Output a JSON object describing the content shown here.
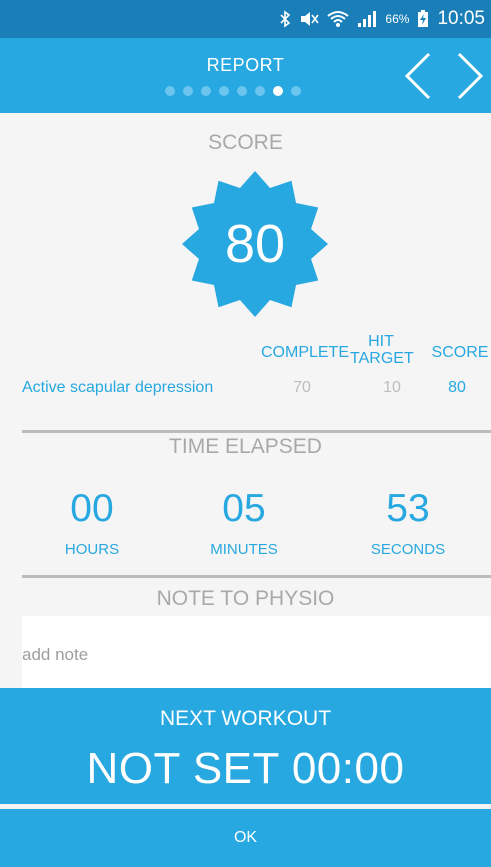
{
  "status_bar": {
    "battery_percent": "66%",
    "clock": "10:05",
    "icons": [
      "bluetooth-icon",
      "mute-icon",
      "wifi-icon",
      "signal-icon",
      "battery-charging-icon"
    ]
  },
  "header": {
    "title": "REPORT",
    "page_count": 8,
    "active_page": 7,
    "prev_icon": "chevron-left-icon",
    "next_icon": "chevron-right-icon"
  },
  "score": {
    "heading": "SCORE",
    "value": "80",
    "badge_color": "#27a8e0"
  },
  "results_table": {
    "columns": {
      "complete": "COMPLETE",
      "hit_target_line1": "HIT",
      "hit_target_line2": "TARGET",
      "score": "SCORE"
    },
    "rows": [
      {
        "exercise": "Active scapular depression",
        "complete": "70",
        "hit_target": "10",
        "score": "80"
      }
    ]
  },
  "time_elapsed": {
    "heading": "TIME ELAPSED",
    "hours": {
      "value": "00",
      "label": "HOURS"
    },
    "minutes": {
      "value": "05",
      "label": "MINUTES"
    },
    "seconds": {
      "value": "53",
      "label": "SECONDS"
    }
  },
  "note": {
    "heading": "NOTE TO PHYSIO",
    "placeholder": "add note",
    "value": ""
  },
  "next_workout": {
    "label": "NEXT WORKOUT",
    "value": "NOT SET 00:00"
  },
  "ok_label": "OK",
  "colors": {
    "accent": "#27a8e0",
    "status_bar": "#1a7fb8",
    "muted_text": "#a9a9a9",
    "background": "#f5f5f5"
  }
}
